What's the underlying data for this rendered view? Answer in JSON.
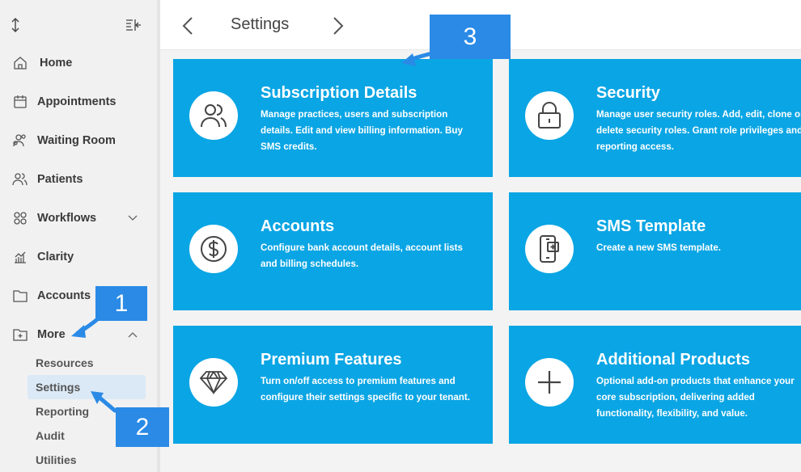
{
  "sidebar": {
    "items": [
      {
        "label": "Home",
        "icon": "home-icon"
      },
      {
        "label": "Appointments",
        "icon": "calendar-icon"
      },
      {
        "label": "Waiting Room",
        "icon": "people-icon"
      },
      {
        "label": "Patients",
        "icon": "users-icon"
      },
      {
        "label": "Workflows",
        "icon": "workflow-icon"
      },
      {
        "label": "Clarity",
        "icon": "chart-icon"
      },
      {
        "label": "Accounts",
        "icon": "folder-icon"
      },
      {
        "label": "More",
        "icon": "folder-plus-icon"
      }
    ],
    "subitems": [
      "Resources",
      "Settings",
      "Reporting",
      "Audit",
      "Utilities"
    ]
  },
  "header": {
    "title": "Settings"
  },
  "cards": [
    {
      "title": "Subscription Details",
      "desc": "Manage practices, users and subscription details. Edit and view billing information. Buy SMS credits.",
      "icon": "users-icon"
    },
    {
      "title": "Security",
      "desc": "Manage user security roles. Add, edit, clone or delete security roles. Grant role privileges and reporting access.",
      "icon": "lock-icon"
    },
    {
      "title": "Accounts",
      "desc": "Configure bank account details, account lists and billing schedules.",
      "icon": "dollar-icon"
    },
    {
      "title": "SMS Template",
      "desc": "Create a new SMS template.",
      "icon": "mobile-message-icon"
    },
    {
      "title": "Premium Features",
      "desc": "Turn on/off access to premium features and configure their settings specific to your tenant.",
      "icon": "diamond-icon"
    },
    {
      "title": "Additional Products",
      "desc": "Optional add-on products that enhance your core subscription, delivering added functionality, flexibility, and value.",
      "icon": "plus-icon"
    }
  ],
  "callouts": [
    "1",
    "2",
    "3"
  ],
  "colors": {
    "card": "#0aa5e4",
    "callout": "#2a8ae6",
    "active": "#dbe9f6"
  }
}
